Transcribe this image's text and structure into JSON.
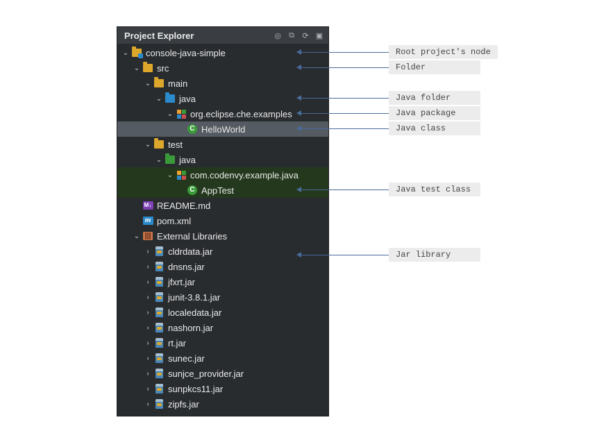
{
  "panel": {
    "title": "Project Explorer"
  },
  "tree": {
    "project": "console-java-simple",
    "src": "src",
    "main": "main",
    "main_java": "java",
    "main_pkg": "org.eclipse.che.examples",
    "main_class": "HelloWorld",
    "test": "test",
    "test_java": "java",
    "test_pkg": "com.codenvy.example.java",
    "test_class": "AppTest",
    "readme": "README.md",
    "pom": "pom.xml",
    "extlib": "External Libraries",
    "jars": [
      "cldrdata.jar",
      "dnsns.jar",
      "jfxrt.jar",
      "junit-3.8.1.jar",
      "localedata.jar",
      "nashorn.jar",
      "rt.jar",
      "sunec.jar",
      "sunjce_provider.jar",
      "sunpkcs11.jar",
      "zipfs.jar"
    ]
  },
  "annotations": {
    "root": "Root project's node",
    "folder": "Folder",
    "java_folder": "Java folder",
    "java_package": "Java package",
    "java_class": "Java class",
    "java_test_class": "Java test class",
    "jar_library": "Jar library"
  },
  "icons": {
    "md_text": "M↓",
    "m_text": "m",
    "class_text": "C"
  }
}
